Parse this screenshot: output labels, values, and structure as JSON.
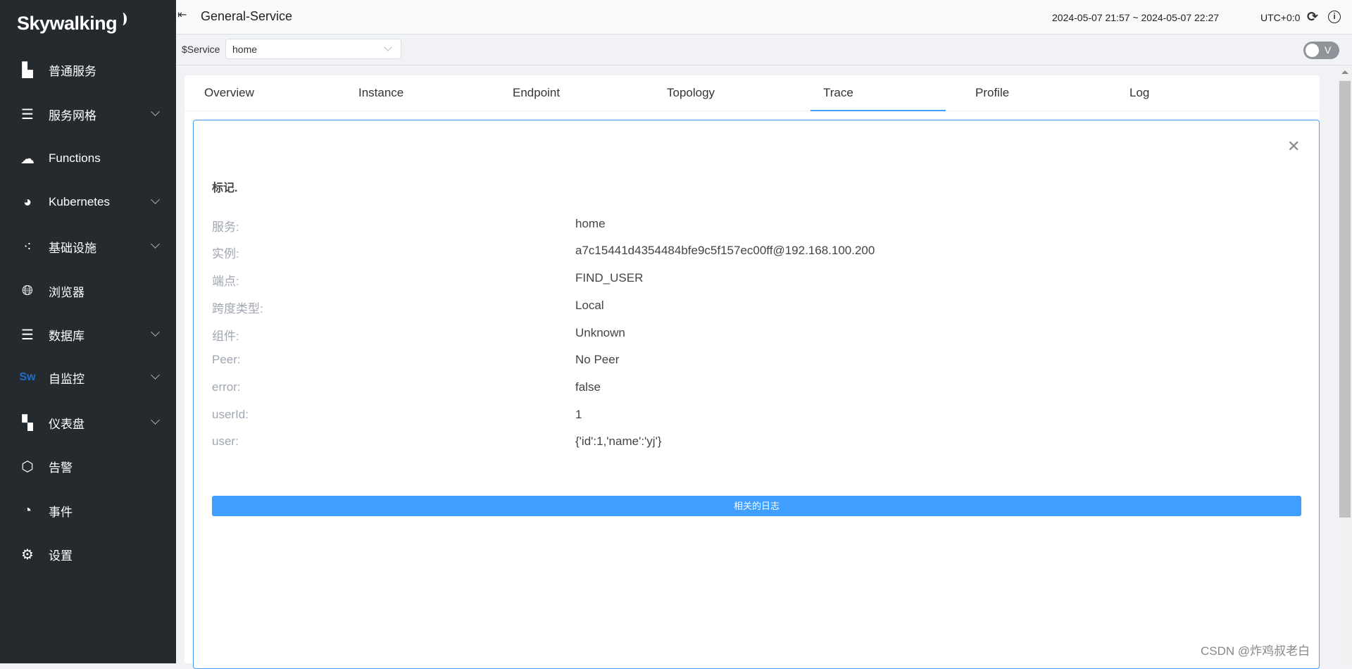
{
  "sidebar": {
    "logo": "Skywalking",
    "items": [
      {
        "label": "普通服务",
        "icon": "chart-area-icon",
        "expandable": false
      },
      {
        "label": "服务网格",
        "icon": "mesh-icon",
        "expandable": true
      },
      {
        "label": "Functions",
        "icon": "cloud-icon",
        "expandable": false
      },
      {
        "label": "Kubernetes",
        "icon": "kubernetes-icon",
        "expandable": true
      },
      {
        "label": "基础设施",
        "icon": "infrastructure-icon",
        "expandable": true
      },
      {
        "label": "浏览器",
        "icon": "globe-icon",
        "expandable": false
      },
      {
        "label": "数据库",
        "icon": "database-icon",
        "expandable": true
      },
      {
        "label": "自监控",
        "icon": "sw-icon",
        "expandable": true
      },
      {
        "label": "仪表盘",
        "icon": "dashboard-add-icon",
        "expandable": true
      },
      {
        "label": "告警",
        "icon": "alert-icon",
        "expandable": false
      },
      {
        "label": "事件",
        "icon": "event-icon",
        "expandable": false
      },
      {
        "label": "设置",
        "icon": "gear-icon",
        "expandable": false
      }
    ]
  },
  "header": {
    "title": "General-Service",
    "time_range": "2024-05-07 21:57 ~ 2024-05-07 22:27",
    "timezone": "UTC+0:0"
  },
  "filter": {
    "label": "$Service",
    "value": "home",
    "toggle_label": "V",
    "toggle_on": false
  },
  "tabs": [
    {
      "label": "Overview"
    },
    {
      "label": "Instance"
    },
    {
      "label": "Endpoint"
    },
    {
      "label": "Topology"
    },
    {
      "label": "Trace",
      "active": true
    },
    {
      "label": "Profile"
    },
    {
      "label": "Log"
    }
  ],
  "panel": {
    "title": "标记.",
    "rows": [
      {
        "key": "服务:",
        "value": "home"
      },
      {
        "key": "实例:",
        "value": "a7c15441d4354484bfe9c5f157ec00ff@192.168.100.200"
      },
      {
        "key": "端点:",
        "value": "FIND_USER"
      },
      {
        "key": "跨度类型:",
        "value": "Local"
      },
      {
        "key": "组件:",
        "value": "Unknown"
      },
      {
        "key": "Peer:",
        "value": "No Peer"
      },
      {
        "key": "error:",
        "value": "false"
      },
      {
        "key": "userId:",
        "value": "1"
      },
      {
        "key": "user:",
        "value": "{'id':1,'name':'yj'}"
      }
    ],
    "related_logs_button": "相关的日志"
  },
  "watermark": "CSDN @炸鸡叔老白",
  "colors": {
    "accent": "#409eff",
    "sidebar_bg": "#252a2f"
  }
}
